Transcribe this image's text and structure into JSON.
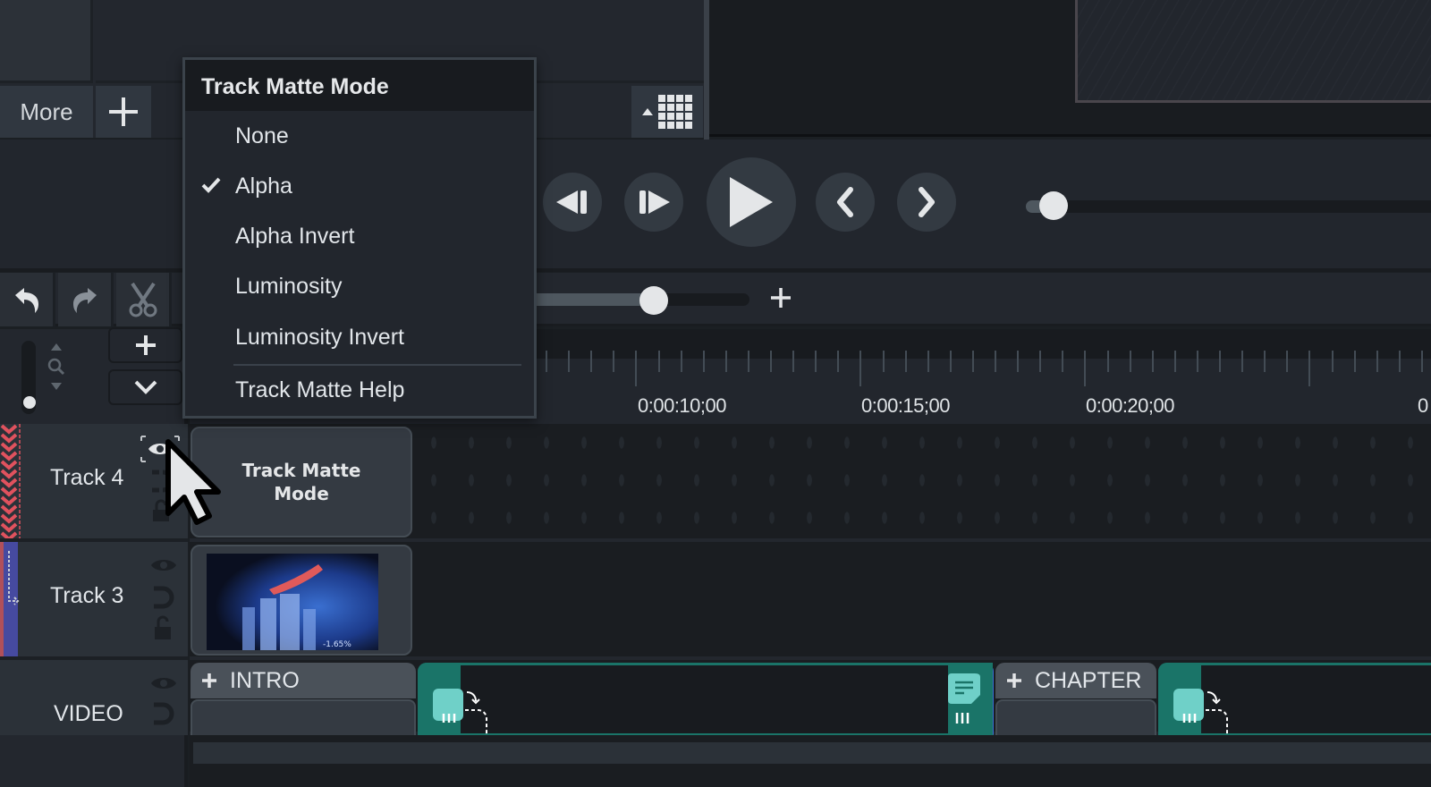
{
  "library": {
    "more_label": "More",
    "add_icon": "plus-icon",
    "grid_icon": "grid-view-icon",
    "grid_toggle_icon": "caret-up-icon"
  },
  "playback": {
    "buttons": [
      {
        "name": "step-back",
        "icon": "step-backward-icon"
      },
      {
        "name": "step-forward",
        "icon": "step-forward-icon"
      },
      {
        "name": "play",
        "icon": "play-icon"
      },
      {
        "name": "previous-marker",
        "icon": "chevron-left-icon"
      },
      {
        "name": "next-marker",
        "icon": "chevron-right-icon"
      }
    ],
    "scrubber_progress": 0.0
  },
  "toolbar": {
    "undo_icon": "undo-icon",
    "redo_icon": "redo-icon",
    "cut_icon": "scissors-icon",
    "zoom_slider_value": 0.56,
    "zoom_in_icon": "plus-icon"
  },
  "track_controls": {
    "add_track_icon": "plus-icon",
    "collapse_icon": "chevron-down-icon",
    "track_height_slider_value": 0.0
  },
  "ruler": {
    "labels": [
      "0:00:10;00",
      "0:00:15;00",
      "0:00:20;00",
      "0"
    ]
  },
  "tracks": [
    {
      "name": "Track 4",
      "clip_label": "Track Matte Mode",
      "matte_color": "#e0525e"
    },
    {
      "name": "Track 3",
      "clip_label": "",
      "matte_color": "#4a4fa8"
    },
    {
      "name": "VIDEO",
      "clips": [
        {
          "type": "group",
          "label": "INTRO"
        },
        {
          "type": "transition"
        },
        {
          "type": "group",
          "label": "CHAPTER"
        },
        {
          "type": "transition"
        }
      ]
    }
  ],
  "context_menu": {
    "title": "Track Matte Mode",
    "items": [
      {
        "label": "None",
        "checked": false
      },
      {
        "label": "Alpha",
        "checked": true
      },
      {
        "label": "Alpha Invert",
        "checked": false
      },
      {
        "label": "Luminosity",
        "checked": false
      },
      {
        "label": "Luminosity Invert",
        "checked": false
      }
    ],
    "help_label": "Track Matte Help"
  },
  "colors": {
    "accent_teal": "#1a7468",
    "teal_light": "#6fd0c8",
    "matte_red": "#e0525e",
    "panel_bg": "#22262d"
  }
}
